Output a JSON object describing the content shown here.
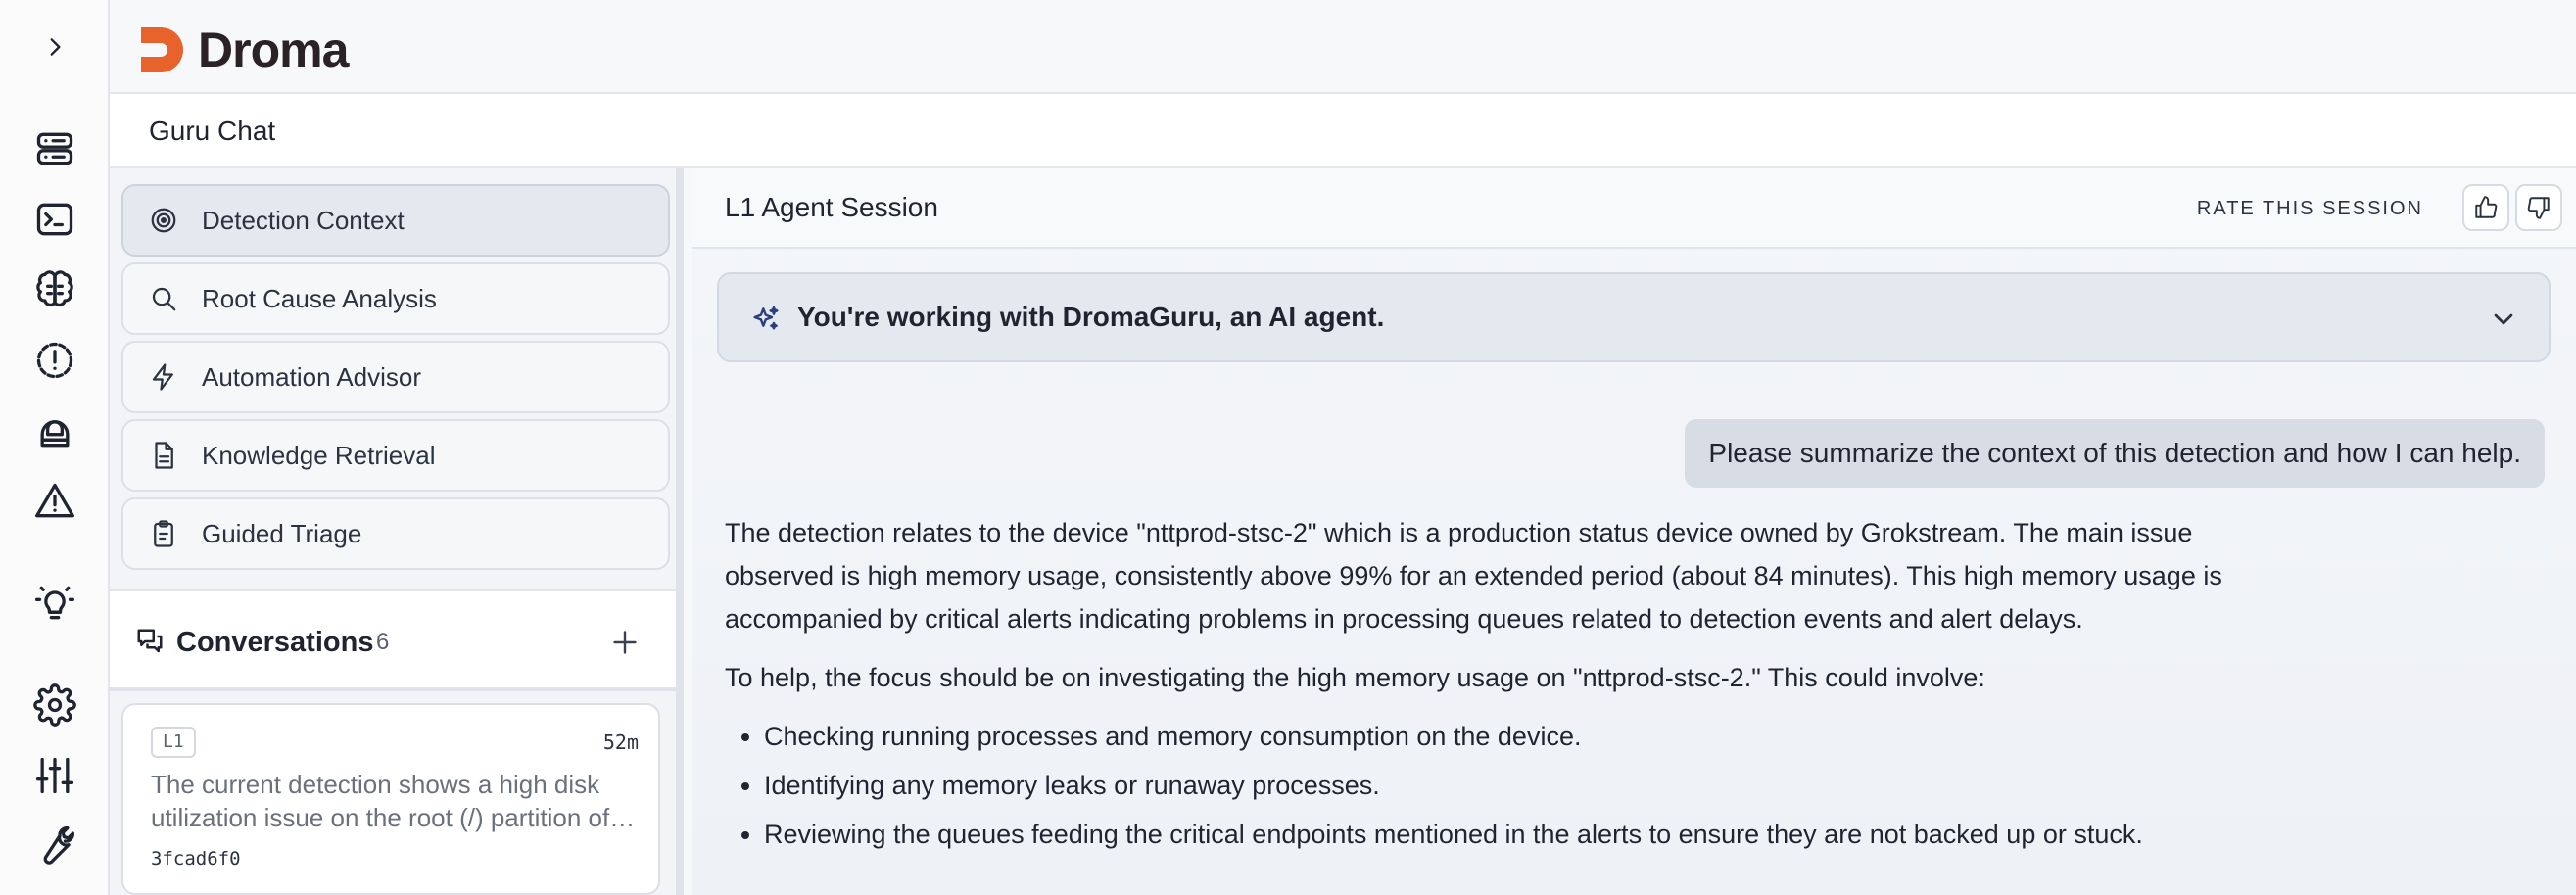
{
  "brand": {
    "name": "Droma",
    "accent": "#e8622c"
  },
  "rail": {
    "icons": [
      "expand-chevron-icon",
      "server-icon",
      "terminal-icon",
      "brain-icon",
      "alert-circle-icon",
      "helmet-icon",
      "warning-triangle-icon",
      "lightbulb-icon",
      "settings-icon",
      "sliders-icon",
      "wrench-icon"
    ]
  },
  "page": {
    "title": "Guru Chat"
  },
  "nav": {
    "items": [
      {
        "label": "Detection Context",
        "icon": "target-icon",
        "active": true
      },
      {
        "label": "Root Cause Analysis",
        "icon": "search-icon",
        "active": false
      },
      {
        "label": "Automation Advisor",
        "icon": "lightning-icon",
        "active": false
      },
      {
        "label": "Knowledge Retrieval",
        "icon": "document-icon",
        "active": false
      },
      {
        "label": "Guided Triage",
        "icon": "clipboard-icon",
        "active": false
      }
    ]
  },
  "conversations": {
    "title": "Conversations",
    "count": "6",
    "items": [
      {
        "badge": "L1",
        "time": "52m",
        "snippet": "The current detection shows a high disk utilization issue on the root (/) partition of the device.",
        "id": "3fcad6f0"
      }
    ]
  },
  "session": {
    "title": "L1 Agent Session",
    "rate_label": "RATE THIS SESSION",
    "agent_banner": "You're working with DromaGuru, an AI agent.",
    "user_message": "Please summarize the context of this detection and how I can help.",
    "reply": {
      "paragraph1": "The detection relates to the device \"nttprod-stsc-2\" which is a production status device owned by Grokstream. The main issue observed is high memory usage, consistently above 99% for an extended period (about 84 minutes). This high memory usage is accompanied by critical alerts indicating problems in processing queues related to detection events and alert delays.",
      "paragraph2": "To help, the focus should be on investigating the high memory usage on \"nttprod-stsc-2.\" This could involve:",
      "bullets": [
        "Checking running processes and memory consumption on the device.",
        "Identifying any memory leaks or runaway processes.",
        "Reviewing the queues feeding the critical endpoints mentioned in the alerts to ensure they are not backed up or stuck."
      ]
    }
  }
}
